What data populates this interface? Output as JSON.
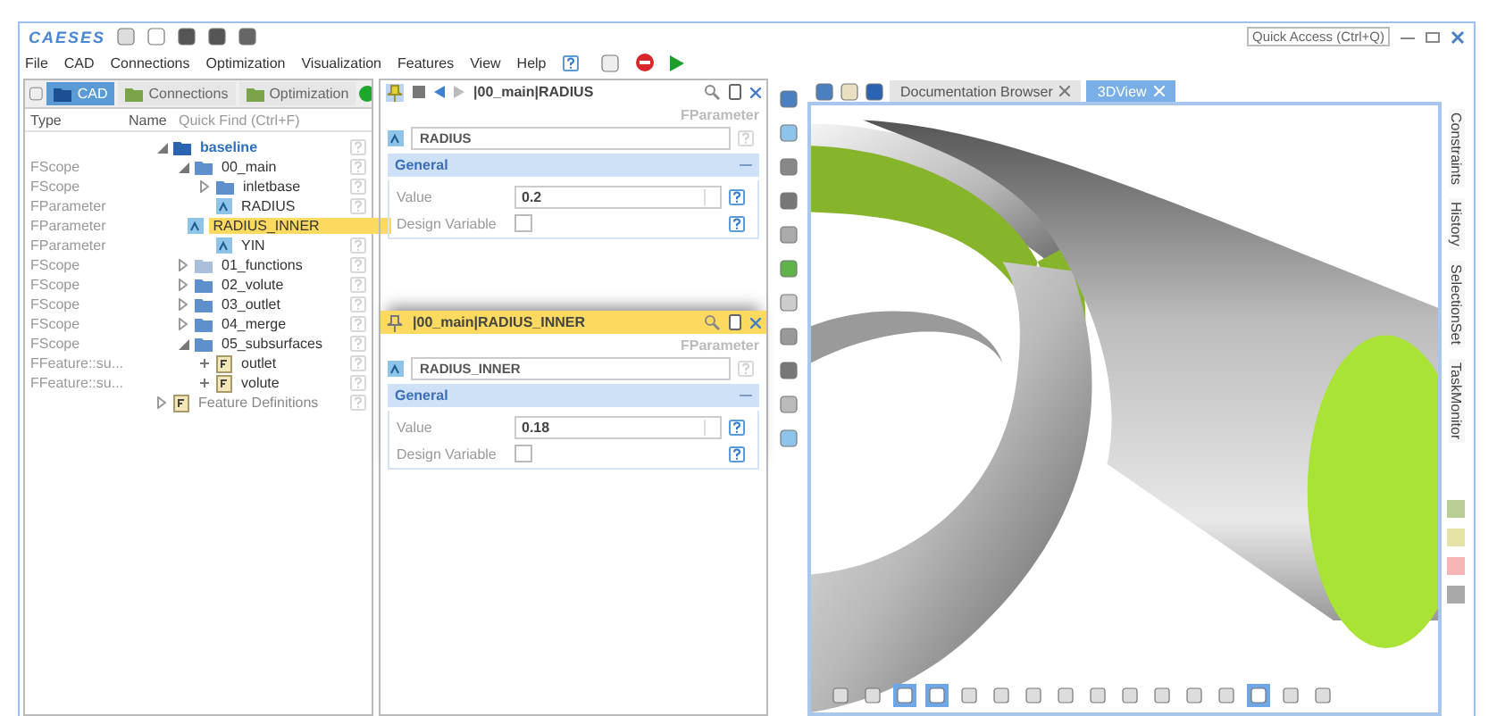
{
  "app": {
    "logo": "CAESES",
    "quick_access": {
      "placeholder": "Quick Access (Ctrl+Q)"
    }
  },
  "menu": [
    "File",
    "CAD",
    "Connections",
    "Optimization",
    "Visualization",
    "Features",
    "View",
    "Help"
  ],
  "left_panel": {
    "tabs": [
      {
        "label": "CAD",
        "selected": true
      },
      {
        "label": "Connections",
        "selected": false
      },
      {
        "label": "Optimization",
        "selected": false
      }
    ],
    "columns": [
      "Type",
      "Name"
    ],
    "quick_find": {
      "placeholder": "Quick Find (Ctrl+F)"
    },
    "tree": [
      {
        "kind": "root",
        "name": "baseline",
        "expanded": true,
        "children": [
          {
            "kind": "scope",
            "type": "FScope",
            "name": "00_main",
            "expanded": true,
            "children": [
              {
                "kind": "scope",
                "type": "FScope",
                "name": "inletbase",
                "expanded": false
              },
              {
                "kind": "parameter",
                "type": "FParameter",
                "name": "RADIUS",
                "selected": false
              },
              {
                "kind": "parameter",
                "type": "FParameter",
                "name": "RADIUS_INNER",
                "selected": true
              },
              {
                "kind": "parameter",
                "type": "FParameter",
                "name": "YIN",
                "selected": false
              }
            ]
          },
          {
            "kind": "scope",
            "type": "FScope",
            "name": "01_functions",
            "expanded": false
          },
          {
            "kind": "scope",
            "type": "FScope",
            "name": "02_volute",
            "expanded": false
          },
          {
            "kind": "scope",
            "type": "FScope",
            "name": "03_outlet",
            "expanded": false
          },
          {
            "kind": "scope",
            "type": "FScope",
            "name": "04_merge",
            "expanded": false
          },
          {
            "kind": "scope",
            "type": "FScope",
            "name": "05_subsurfaces",
            "expanded": true,
            "children": [
              {
                "kind": "feature",
                "type": "FFeature::su...",
                "name": "outlet"
              },
              {
                "kind": "feature",
                "type": "FFeature::su...",
                "name": "volute"
              }
            ]
          }
        ]
      },
      {
        "kind": "definitions",
        "name": "Feature Definitions",
        "expanded": false
      }
    ]
  },
  "editors": [
    {
      "title": "|00_main|RADIUS",
      "selected": false,
      "navigation": true,
      "type_label": "FParameter",
      "name": "RADIUS",
      "section": "General",
      "value_label": "Value",
      "value": "0.2",
      "design_variable_label": "Design Variable",
      "design_variable": false
    },
    {
      "title": "|00_main|RADIUS_INNER",
      "selected": true,
      "navigation": false,
      "type_label": "FParameter",
      "name": "RADIUS_INNER",
      "section": "General",
      "value_label": "Value",
      "value": "0.18",
      "design_variable_label": "Design Variable",
      "design_variable": false
    }
  ],
  "view_tabs": [
    {
      "label": "Documentation Browser",
      "selected": false
    },
    {
      "label": "3DView",
      "selected": true
    }
  ],
  "view_toolbar": [
    {
      "selected": false
    },
    {
      "selected": false
    },
    {
      "selected": true
    },
    {
      "selected": true
    },
    {
      "selected": false
    },
    {
      "selected": false
    },
    {
      "selected": false
    },
    {
      "selected": false
    },
    {
      "selected": false
    },
    {
      "selected": false
    },
    {
      "selected": false
    },
    {
      "selected": false
    },
    {
      "selected": false
    },
    {
      "selected": true
    },
    {
      "selected": false
    },
    {
      "selected": false
    }
  ],
  "side_tabs": [
    "Constraints",
    "History",
    "SelectionSet",
    "TaskMonitor"
  ],
  "swatches": [
    {
      "color": "#b9cf96"
    },
    {
      "color": "#e3e3a6"
    },
    {
      "color": "#f5b5b5"
    },
    {
      "color": "#a9a9a9"
    }
  ]
}
